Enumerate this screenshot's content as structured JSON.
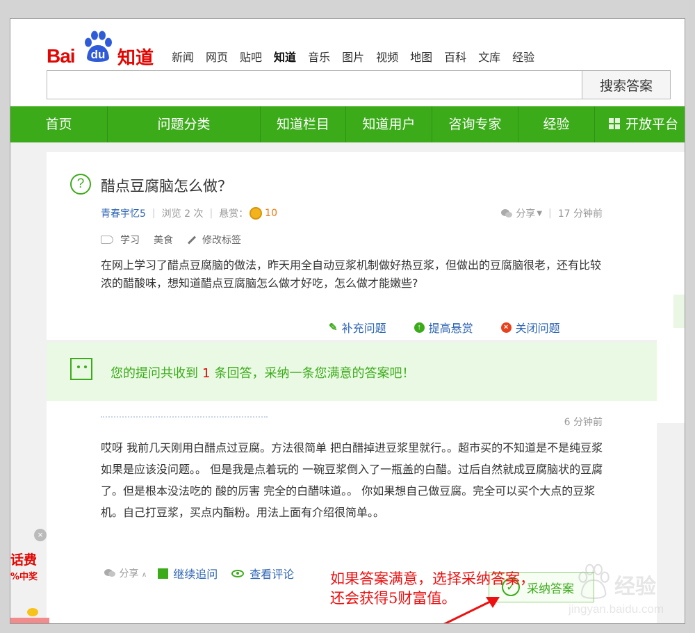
{
  "logo": {
    "bai": "Bai",
    "du": "du",
    "zhidao": "知道"
  },
  "topnav": {
    "items": [
      "新闻",
      "网页",
      "贴吧",
      "知道",
      "音乐",
      "图片",
      "视频",
      "地图",
      "百科",
      "文库",
      "经验"
    ],
    "active_index": 3
  },
  "search": {
    "value": "",
    "button": "搜索答案"
  },
  "mainnav": {
    "items": [
      "首页",
      "问题分类",
      "知道栏目",
      "知道用户",
      "咨询专家",
      "经验",
      "开放平台"
    ]
  },
  "question": {
    "title": "醋点豆腐脑怎么做？",
    "user": "青春宇忆5",
    "views": "浏览 2 次",
    "reward_label": "悬赏：",
    "reward_value": "10",
    "share": "分享",
    "time": "17 分钟前",
    "tags": [
      "学习",
      "美食"
    ],
    "edit_tags": "修改标签",
    "body": "在网上学习了醋点豆腐脑的做法，昨天用全自动豆浆机制做好热豆浆，但做出的豆腐脑很老，还有比较浓的醋酸味，想知道醋点豆腐脑怎么做才好吃，怎么做才能嫩些?",
    "actions": [
      "补充问题",
      "提高悬赏",
      "关闭问题"
    ]
  },
  "notice": {
    "prefix": "您的提问共收到",
    "count": "1",
    "suffix": "条回答，采纳一条您满意的答案吧！"
  },
  "answer": {
    "time": "6 分钟前",
    "body": "哎呀 我前几天刚用白醋点过豆腐。方法很简单 把白醋掉进豆浆里就行。。超市买的不知道是不是纯豆浆 如果是应该没问题。。 但是我是点着玩的 一碗豆浆倒入了一瓶盖的白醋。过后自然就成豆腐脑状的豆腐了。但是根本没法吃的 酸的厉害 完全的白醋味道。。 你如果想自己做豆腐。完全可以买个大点的豆浆机。自己打豆浆，买点内酯粉。用法上面有介绍很简单。。",
    "share": "分享",
    "follow_up": "继续追问",
    "view_comments": "查看评论",
    "adopt": "采纳答案"
  },
  "annotation": {
    "line1": "如果答案满意，选择采纳答案，",
    "line2": "还会获得5财富值。"
  },
  "ad": {
    "close": "×",
    "line1": "话费",
    "line2": "%中奖"
  },
  "watermark": {
    "text": "经验",
    "url": "jingyan.baidu.com"
  },
  "colors": {
    "brand_green": "#3cab1a",
    "baidu_red": "#e10602",
    "link_blue": "#2d64b3",
    "annotation_red": "#ee1010"
  }
}
